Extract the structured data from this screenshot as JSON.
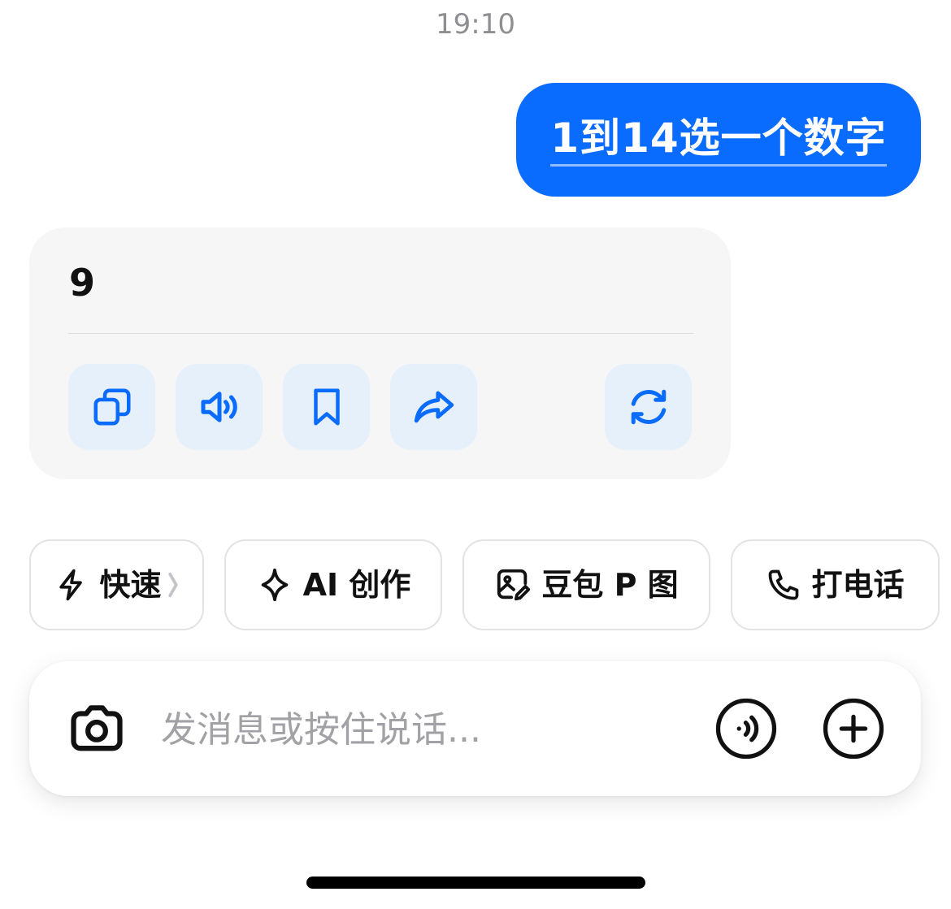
{
  "status": {
    "time": "19:10"
  },
  "conversation": {
    "user_message": "1到14选一个数字",
    "assistant_reply": "9"
  },
  "reply_actions": [
    {
      "name": "copy",
      "icon": "copy-icon"
    },
    {
      "name": "read-aloud",
      "icon": "speaker-icon"
    },
    {
      "name": "bookmark",
      "icon": "bookmark-icon"
    },
    {
      "name": "share",
      "icon": "share-icon"
    },
    {
      "name": "regenerate",
      "icon": "refresh-icon"
    }
  ],
  "quick_chips": [
    {
      "label": "快速",
      "icon": "lightning-icon"
    },
    {
      "label": "AI 创作",
      "icon": "sparkle-icon"
    },
    {
      "label": "豆包 P 图",
      "icon": "image-edit-icon"
    },
    {
      "label": "打电话",
      "icon": "phone-icon"
    }
  ],
  "composer": {
    "placeholder": "发消息或按住说话..."
  },
  "colors": {
    "accent": "#0a6cff",
    "action_bg": "#e6f0fb",
    "card_bg": "#f6f6f7"
  }
}
